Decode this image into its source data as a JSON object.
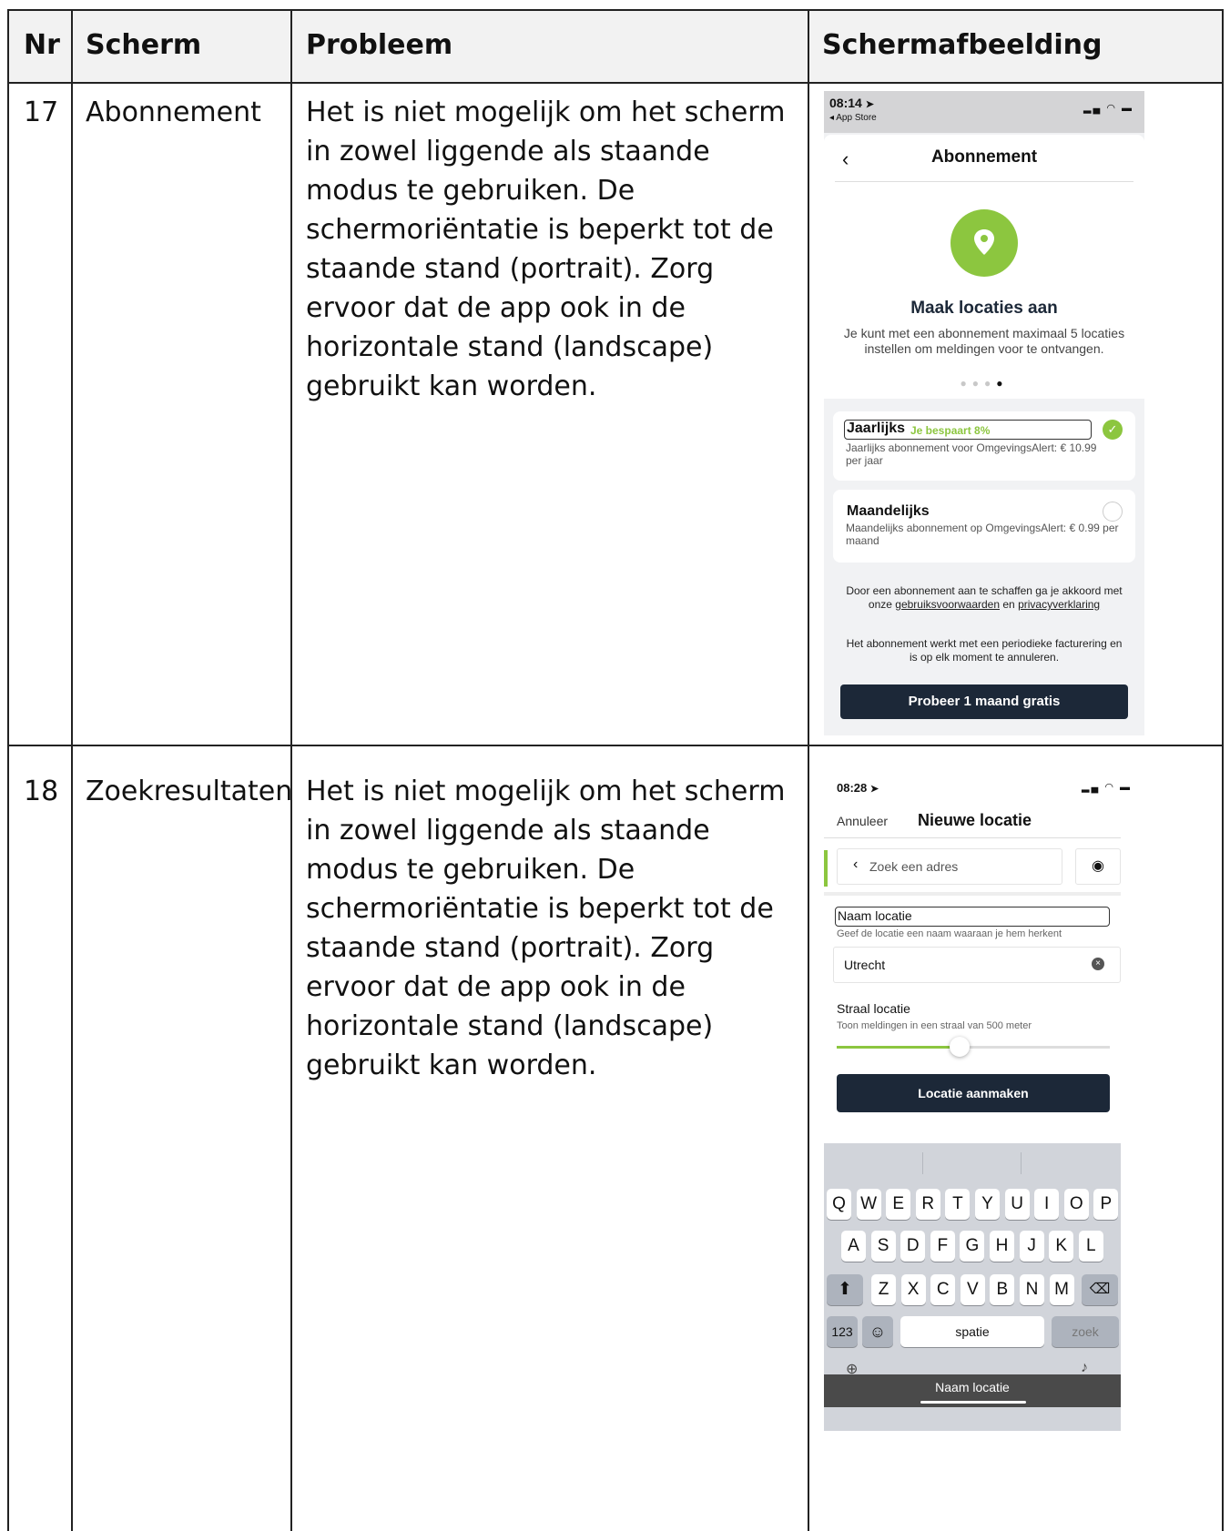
{
  "table": {
    "headers": {
      "nr": "Nr",
      "scherm": "Scherm",
      "probleem": "Probleem",
      "screenshot": "Schermafbeelding"
    },
    "rows": [
      {
        "nr": "17",
        "scherm": "Abonnement",
        "probleem": "Het is niet mogelijk om het scherm in zowel liggende als staande modus te gebruiken. De schermoriëntatie is beperkt tot de staande stand (portrait). Zorg ervoor dat de app ook in de horizontale stand (landscape) gebruikt kan worden."
      },
      {
        "nr": "18",
        "scherm": "Zoekresultaten",
        "probleem": "Het is niet mogelijk om het scherm in zowel liggende als staande modus te gebruiken. De schermoriëntatie is beperkt tot de staande stand (portrait). Zorg ervoor dat de app ook in de horizontale stand (landscape) gebruikt kan worden."
      }
    ]
  },
  "screen1": {
    "time": "08:14",
    "back_app": "◂ App Store",
    "title": "Abonnement",
    "heading": "Maak locaties aan",
    "description": "Je kunt met een abonnement maximaal 5 locaties instellen om meldingen voor te ontvangen.",
    "option_yearly": {
      "title": "Jaarlijks",
      "badge": "Je bespaart 8%",
      "desc": "Jaarlijks abonnement voor OmgevingsAlert: € 10.99 per jaar"
    },
    "option_monthly": {
      "title": "Maandelijks",
      "desc": "Maandelijks abonnement op OmgevingsAlert: € 0.99 per maand"
    },
    "terms_pre": "Door een abonnement aan te schaffen ga je akkoord met onze",
    "terms_link1": "gebruiksvoorwaarden",
    "terms_mid": "en",
    "terms_link2": "privacyverklaring",
    "billing": "Het abonnement werkt met een periodieke facturering en is op elk moment te annuleren.",
    "cta": "Probeer 1 maand gratis",
    "colors": {
      "accent": "#8cc63f",
      "dark": "#1c2838"
    }
  },
  "screen2": {
    "time": "08:28",
    "cancel": "Annuleer",
    "title": "Nieuwe locatie",
    "search_placeholder": "Zoek een adres",
    "name_label": "Naam locatie",
    "name_hint": "Geef de locatie een naam waaraan je hem herkent",
    "name_value": "Utrecht",
    "radius_label": "Straal locatie",
    "radius_hint": "Toon meldingen in een straal van 500 meter",
    "radius_slider_fraction": 0.45,
    "cta": "Locatie aanmaken",
    "keyboard": {
      "row1": [
        "Q",
        "W",
        "E",
        "R",
        "T",
        "Y",
        "U",
        "I",
        "O",
        "P"
      ],
      "row2": [
        "A",
        "S",
        "D",
        "F",
        "G",
        "H",
        "J",
        "K",
        "L"
      ],
      "row3": [
        "Z",
        "X",
        "C",
        "V",
        "B",
        "N",
        "M"
      ],
      "num": "123",
      "space": "spatie",
      "go": "zoek"
    },
    "bottom_label": "Naam locatie"
  }
}
